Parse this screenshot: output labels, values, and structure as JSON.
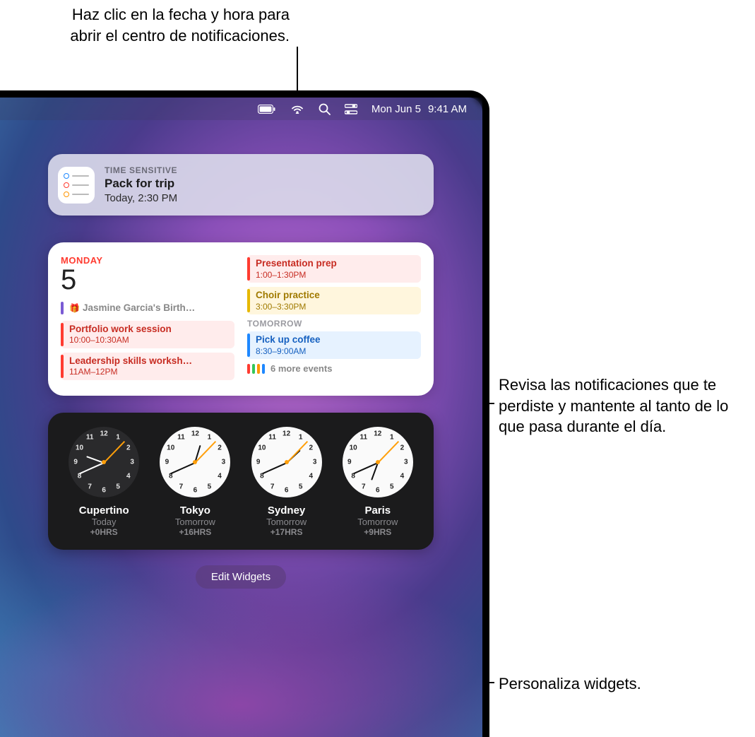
{
  "callouts": {
    "top": "Haz clic en la fecha y hora para abrir el centro de notificaciones.",
    "right1": "Revisa las notificaciones que te perdiste y mantente al tanto de lo que pasa durante el día.",
    "right2": "Personaliza widgets."
  },
  "menubar": {
    "date": "Mon Jun 5",
    "time": "9:41 AM",
    "icons": [
      "battery-icon",
      "wifi-icon",
      "search-icon",
      "control-center-icon"
    ]
  },
  "notification": {
    "label": "TIME SENSITIVE",
    "title": "Pack for trip",
    "subtitle": "Today, 2:30 PM",
    "icon": "reminders-icon",
    "icon_dots": [
      "#1e88ff",
      "#ff3b30",
      "#ff9500"
    ]
  },
  "calendar": {
    "dayname": "MONDAY",
    "daynum": "5",
    "tomorrow_label": "TOMORROW",
    "more_label": "6 more events",
    "more_bar_colors": [
      "#ff3b30",
      "#33c759",
      "#ff9500",
      "#1e88ff"
    ],
    "left_events": [
      {
        "type": "birthday",
        "title": "Jasmine Garcia's Birth…",
        "time": ""
      },
      {
        "type": "red",
        "title": "Portfolio work session",
        "time": "10:00–10:30AM"
      },
      {
        "type": "red",
        "title": "Leadership skills worksh…",
        "time": "11AM–12PM"
      }
    ],
    "right_events": [
      {
        "type": "red",
        "title": "Presentation prep",
        "time": "1:00–1:30PM"
      },
      {
        "type": "yellow",
        "title": "Choir practice",
        "time": "3:00–3:30PM"
      }
    ],
    "tomorrow_events": [
      {
        "type": "blue",
        "title": "Pick up coffee",
        "time": "8:30–9:00AM"
      }
    ]
  },
  "clocks": [
    {
      "city": "Cupertino",
      "day": "Today",
      "offset": "+0HRS",
      "face": "dark",
      "hour_deg": 290,
      "min_deg": 246
    },
    {
      "city": "Tokyo",
      "day": "Tomorrow",
      "offset": "+16HRS",
      "face": "light",
      "hour_deg": 17,
      "min_deg": 246
    },
    {
      "city": "Sydney",
      "day": "Tomorrow",
      "offset": "+17HRS",
      "face": "light",
      "hour_deg": 47,
      "min_deg": 246
    },
    {
      "city": "Paris",
      "day": "Tomorrow",
      "offset": "+9HRS",
      "face": "light",
      "hour_deg": 200,
      "min_deg": 246
    }
  ],
  "clock_sec_deg": 44,
  "edit_widgets_label": "Edit Widgets"
}
